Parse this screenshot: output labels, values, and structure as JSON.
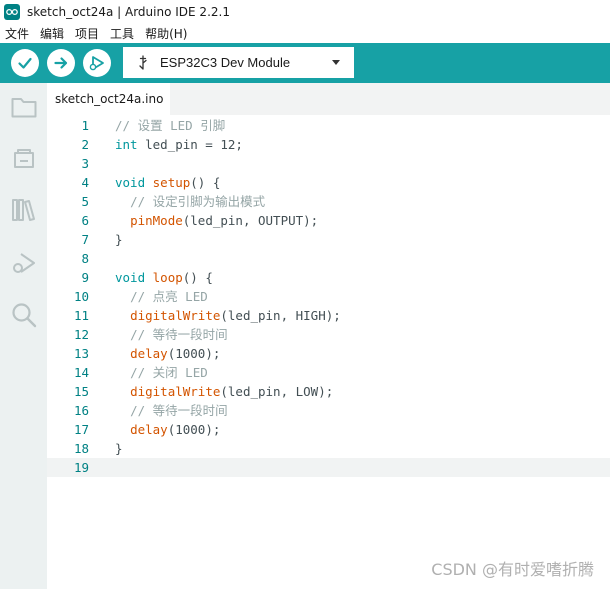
{
  "window": {
    "title": "sketch_oct24a | Arduino IDE 2.2.1"
  },
  "menu": [
    "文件",
    "编辑",
    "项目",
    "工具",
    "帮助(H)"
  ],
  "toolbar": {
    "board": "ESP32C3 Dev Module",
    "accent_color": "#17a1a5"
  },
  "tab": {
    "label": "sketch_oct24a.ino"
  },
  "code": {
    "lines": [
      [
        {
          "t": "// 设置 LED 引脚",
          "c": "comment"
        }
      ],
      [
        {
          "t": "int",
          "c": "type"
        },
        {
          "t": " led_pin = 12;",
          "c": "plain"
        }
      ],
      [],
      [
        {
          "t": "void",
          "c": "type"
        },
        {
          "t": " ",
          "c": "plain"
        },
        {
          "t": "setup",
          "c": "func"
        },
        {
          "t": "() {",
          "c": "plain"
        }
      ],
      [
        {
          "t": "  ",
          "c": "plain"
        },
        {
          "t": "// 设定引脚为输出模式",
          "c": "comment"
        }
      ],
      [
        {
          "t": "  ",
          "c": "plain"
        },
        {
          "t": "pinMode",
          "c": "func"
        },
        {
          "t": "(led_pin, OUTPUT);",
          "c": "plain"
        }
      ],
      [
        {
          "t": "}",
          "c": "plain"
        }
      ],
      [],
      [
        {
          "t": "void",
          "c": "type"
        },
        {
          "t": " ",
          "c": "plain"
        },
        {
          "t": "loop",
          "c": "func"
        },
        {
          "t": "() {",
          "c": "plain"
        }
      ],
      [
        {
          "t": "  ",
          "c": "plain"
        },
        {
          "t": "// 点亮 LED",
          "c": "comment"
        }
      ],
      [
        {
          "t": "  ",
          "c": "plain"
        },
        {
          "t": "digitalWrite",
          "c": "func"
        },
        {
          "t": "(led_pin, HIGH);",
          "c": "plain"
        }
      ],
      [
        {
          "t": "  ",
          "c": "plain"
        },
        {
          "t": "// 等待一段时间",
          "c": "comment"
        }
      ],
      [
        {
          "t": "  ",
          "c": "plain"
        },
        {
          "t": "delay",
          "c": "func"
        },
        {
          "t": "(1000);",
          "c": "plain"
        }
      ],
      [
        {
          "t": "  ",
          "c": "plain"
        },
        {
          "t": "// 关闭 LED",
          "c": "comment"
        }
      ],
      [
        {
          "t": "  ",
          "c": "plain"
        },
        {
          "t": "digitalWrite",
          "c": "func"
        },
        {
          "t": "(led_pin, LOW);",
          "c": "plain"
        }
      ],
      [
        {
          "t": "  ",
          "c": "plain"
        },
        {
          "t": "// 等待一段时间",
          "c": "comment"
        }
      ],
      [
        {
          "t": "  ",
          "c": "plain"
        },
        {
          "t": "delay",
          "c": "func"
        },
        {
          "t": "(1000);",
          "c": "plain"
        }
      ],
      [
        {
          "t": "}",
          "c": "plain"
        }
      ],
      []
    ],
    "line_numbers": [
      "1",
      "2",
      "3",
      "4",
      "5",
      "6",
      "7",
      "8",
      "9",
      "10",
      "11",
      "12",
      "13",
      "14",
      "15",
      "16",
      "17",
      "18",
      "19"
    ],
    "current_line": "19"
  },
  "watermark": "CSDN @有时爱嗜折腾"
}
